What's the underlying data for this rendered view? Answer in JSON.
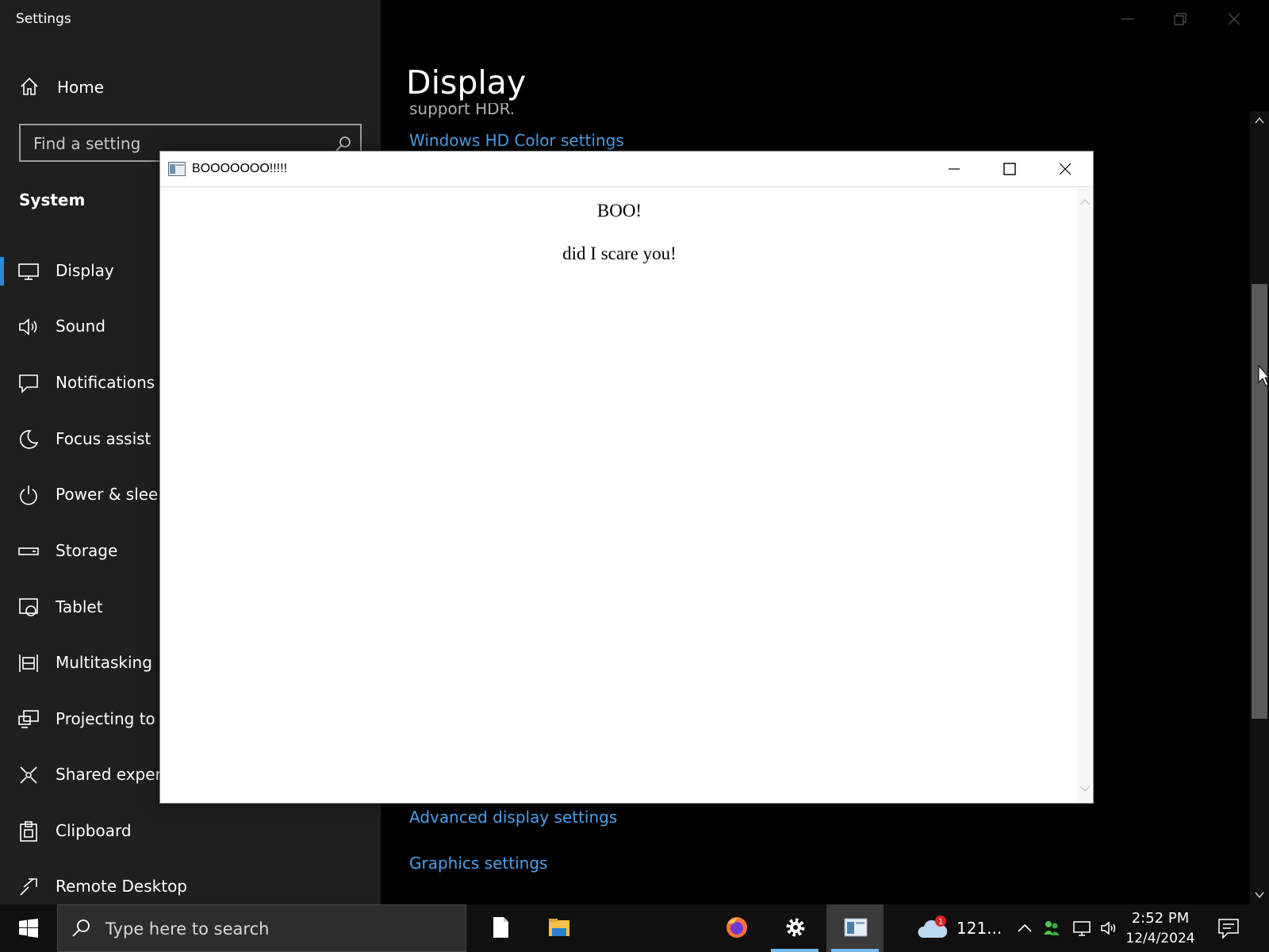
{
  "settings": {
    "app_title": "Settings",
    "home_label": "Home",
    "search_placeholder": "Find a setting",
    "section_title": "System",
    "nav_items": [
      {
        "label": "Display",
        "icon": "monitor-icon",
        "active": true
      },
      {
        "label": "Sound",
        "icon": "speaker-icon"
      },
      {
        "label": "Notifications &",
        "icon": "notification-icon"
      },
      {
        "label": "Focus assist",
        "icon": "moon-icon"
      },
      {
        "label": "Power & sleep",
        "icon": "power-icon"
      },
      {
        "label": "Storage",
        "icon": "storage-icon"
      },
      {
        "label": "Tablet",
        "icon": "tablet-icon"
      },
      {
        "label": "Multitasking",
        "icon": "multitasking-icon"
      },
      {
        "label": "Projecting to t",
        "icon": "projecting-icon"
      },
      {
        "label": "Shared experie",
        "icon": "shared-experiences-icon"
      },
      {
        "label": "Clipboard",
        "icon": "clipboard-icon"
      },
      {
        "label": "Remote Desktop",
        "icon": "remote-desktop-icon"
      }
    ],
    "page_heading": "Display",
    "clipped_text": "support HDR.",
    "links": {
      "hd_color": "Windows HD Color settings",
      "advanced_display": "Advanced display settings",
      "graphics": "Graphics settings"
    },
    "colors": {
      "sidebar_bg": "#1f1f1f",
      "content_bg": "#000000",
      "link": "#4ca0e8",
      "accent": "#2b88d8"
    }
  },
  "popup": {
    "title": "BOOOOOOO!!!!!",
    "heading": "BOO!",
    "message": "did I scare you!"
  },
  "taskbar": {
    "search_placeholder": "Type here to search",
    "apps": [
      "file-icon",
      "file-explorer-icon",
      "firefox-icon",
      "settings-gear-icon",
      "app-window-icon"
    ],
    "weather_value": "121...",
    "weather_badge": "1",
    "clock_time": "2:52 PM",
    "clock_date": "12/4/2024"
  }
}
